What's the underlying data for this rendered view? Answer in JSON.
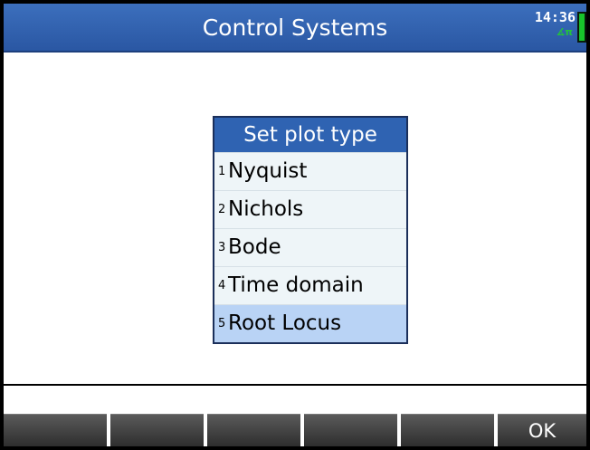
{
  "title_bar": {
    "title": "Control Systems",
    "clock": "14:36",
    "angle_mode": "∡π"
  },
  "dialog": {
    "header": "Set plot type",
    "items": [
      {
        "num": "1",
        "label": "Nyquist"
      },
      {
        "num": "2",
        "label": "Nichols"
      },
      {
        "num": "3",
        "label": "Bode"
      },
      {
        "num": "4",
        "label": "Time domain"
      },
      {
        "num": "5",
        "label": "Root Locus"
      }
    ],
    "selected_index": 4
  },
  "softkeys": [
    "",
    "",
    "",
    "",
    "",
    "OK"
  ],
  "colors": {
    "title_bar": "#2f63b2",
    "selection": "#b9d3f5",
    "battery": "#18c42b"
  }
}
